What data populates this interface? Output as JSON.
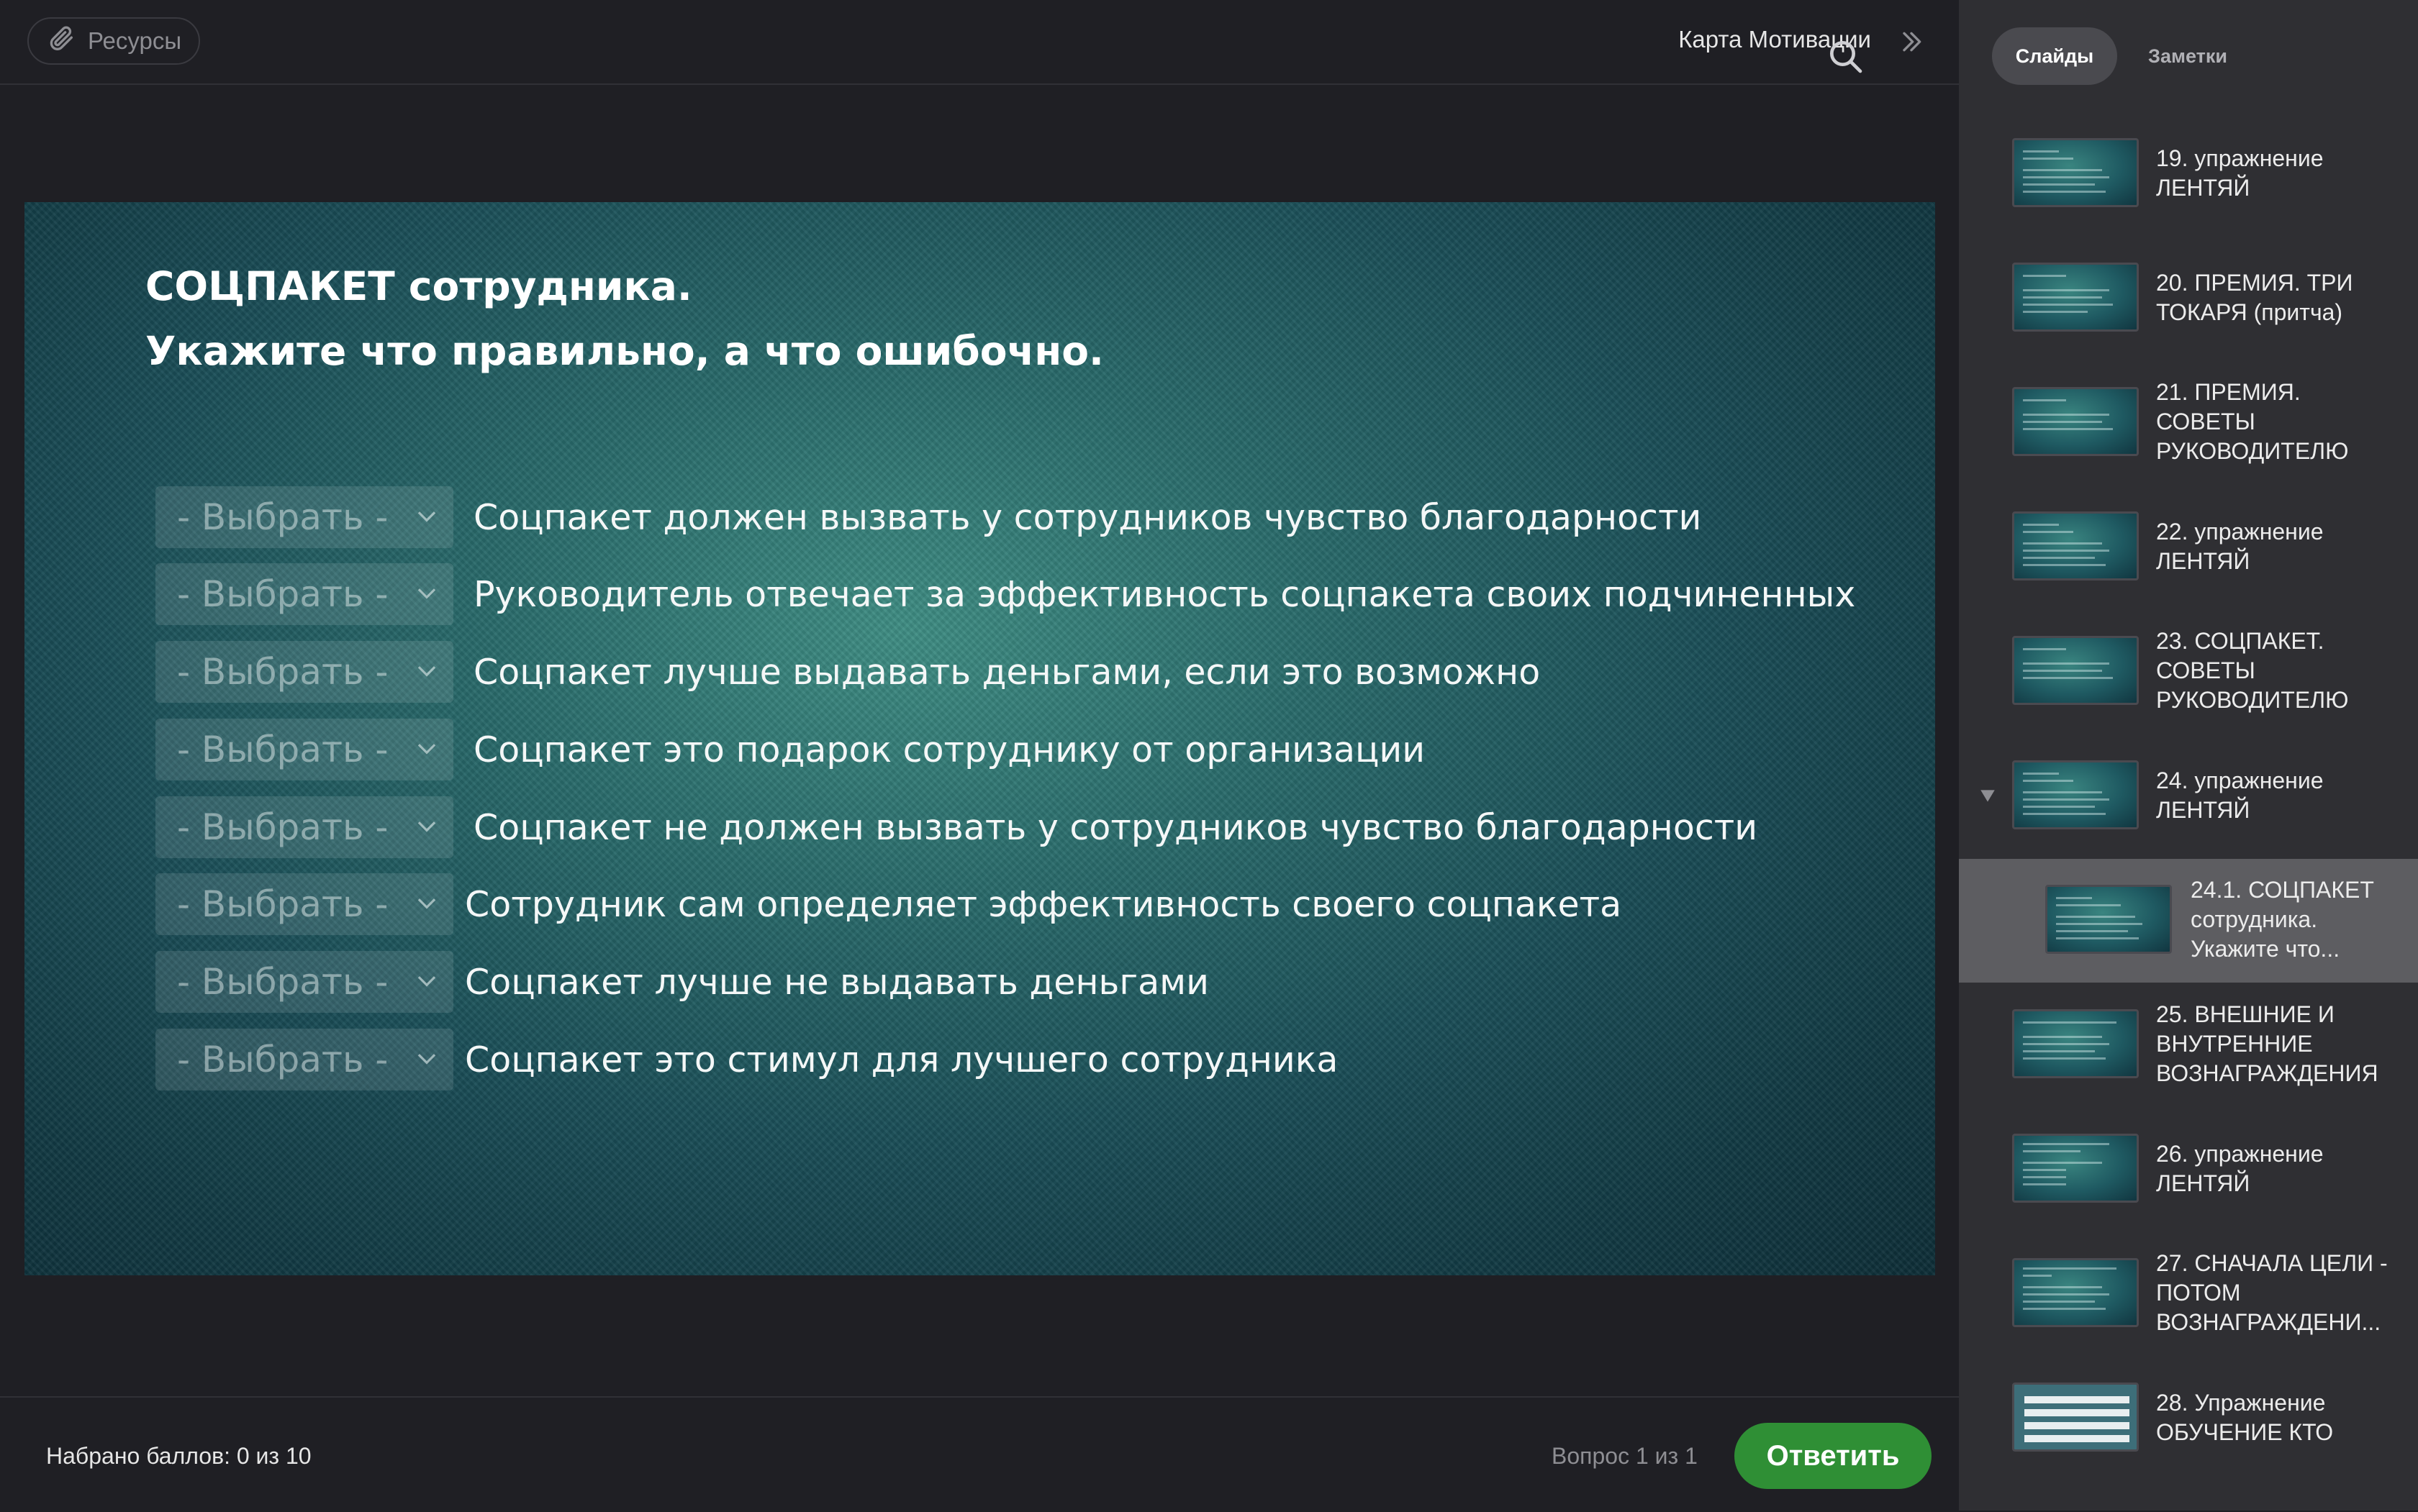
{
  "header": {
    "resources_label": "Ресурсы",
    "course_title": "Карта Мотивации"
  },
  "slide": {
    "title_line1": "СОЦПАКЕТ сотрудника.",
    "title_line2": "Укажите что правильно, а что ошибочно.",
    "select_placeholder": "- Выбрать -",
    "statements": [
      "Соцпакет должен вызвать у сотрудников чувство благодарности",
      "Руководитель отвечает за эффективность соцпакета  своих подчиненных",
      "Соцпакет лучше выдавать деньгами, если это возможно",
      "Соцпакет это подарок сотруднику от организации",
      "Соцпакет не должен вызвать у сотрудников чувство благодарности",
      "Сотрудник сам определяет  эффективность своего соцпакета",
      "Соцпакет лучше не выдавать деньгами",
      "Соцпакет это стимул для лучшего сотрудника"
    ]
  },
  "footer": {
    "score": "Набрано баллов: 0 из 10",
    "question_count": "Вопрос 1 из 1",
    "answer_button": "Ответить"
  },
  "sidebar": {
    "tabs": {
      "slides": "Слайды",
      "notes": "Заметки"
    },
    "items": [
      {
        "line1": "19. упражнение",
        "line2": "ЛЕНТЯЙ",
        "line3": ""
      },
      {
        "line1": "20. ПРЕМИЯ. ТРИ",
        "line2": "ТОКАРЯ (притча)",
        "line3": ""
      },
      {
        "line1": "21. ПРЕМИЯ.",
        "line2": "СОВЕТЫ",
        "line3": "РУКОВОДИТЕЛЮ"
      },
      {
        "line1": "22. упражнение",
        "line2": "ЛЕНТЯЙ",
        "line3": ""
      },
      {
        "line1": "23. СОЦПАКЕТ.",
        "line2": "СОВЕТЫ",
        "line3": "РУКОВОДИТЕЛЮ"
      },
      {
        "line1": "24. упражнение",
        "line2": "ЛЕНТЯЙ",
        "line3": ""
      },
      {
        "line1": "24.1. СОЦПАКЕТ",
        "line2": "сотрудника.",
        "line3": "Укажите что..."
      },
      {
        "line1": "25. ВНЕШНИЕ И",
        "line2": "ВНУТРЕННИЕ",
        "line3": "ВОЗНАГРАЖДЕНИЯ"
      },
      {
        "line1": "26. упражнение",
        "line2": "ЛЕНТЯЙ",
        "line3": ""
      },
      {
        "line1": "27. СНАЧАЛА ЦЕЛИ -",
        "line2": "ПОТОМ",
        "line3": "ВОЗНАГРАЖДЕНИ..."
      },
      {
        "line1": "28. Упражнение",
        "line2": "ОБУЧЕНИЕ КТО",
        "line3": ""
      }
    ],
    "selected_index": 6
  },
  "colors": {
    "accent_green": "#2f8f35",
    "background": "#1f1f24",
    "sidebar_bg": "#2f2f33",
    "selected_item_bg": "#5d5d61"
  },
  "icons": [
    "paperclip-icon",
    "double-chevron-right-icon",
    "search-icon",
    "chevron-down-icon",
    "expand-triangle-icon"
  ]
}
